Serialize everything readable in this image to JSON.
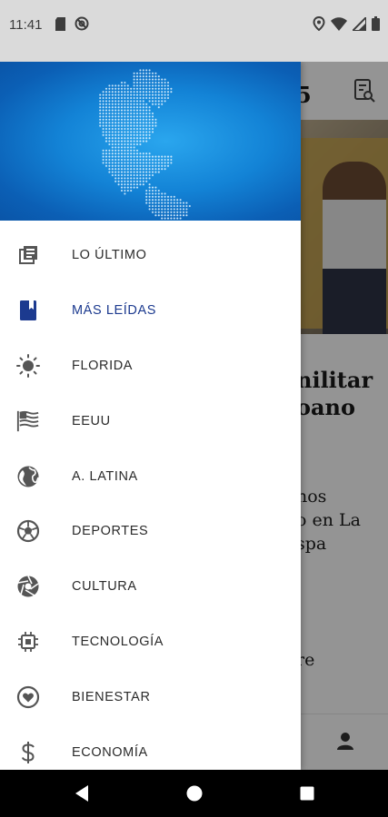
{
  "status_bar": {
    "time": "11:41",
    "left_icons": [
      "sd-card-icon",
      "do-not-disturb-icon"
    ],
    "right_icons": [
      "location-icon",
      "wifi-icon",
      "signal-icon",
      "battery-icon"
    ]
  },
  "background": {
    "headline_fragment_1": "nilitar",
    "headline_fragment_2": "oano",
    "story_fragment_1": "nos",
    "story_fragment_2": "o en La",
    "story_fragment_3": "spa",
    "story_fragment_4": "re",
    "app_fragment": "5"
  },
  "drawer": {
    "items": [
      {
        "label": "LO ÚLTIMO",
        "icon": "latest-stack-icon",
        "active": false
      },
      {
        "label": "MÁS LEÍDAS",
        "icon": "bookmark-book-icon",
        "active": true
      },
      {
        "label": "FLORIDA",
        "icon": "sun-icon",
        "active": false
      },
      {
        "label": "EEUU",
        "icon": "us-flag-icon",
        "active": false
      },
      {
        "label": "A. LATINA",
        "icon": "globe-icon",
        "active": false
      },
      {
        "label": "DEPORTES",
        "icon": "soccer-ball-icon",
        "active": false
      },
      {
        "label": "CULTURA",
        "icon": "camera-aperture-icon",
        "active": false
      },
      {
        "label": "TECNOLOGÍA",
        "icon": "chip-icon",
        "active": false
      },
      {
        "label": "BIENESTAR",
        "icon": "heart-icon",
        "active": false
      },
      {
        "label": "ECONOMÍA",
        "icon": "dollar-icon",
        "active": false
      }
    ]
  },
  "colors": {
    "accent": "#1c3a8f",
    "header_blue": "#1383d6",
    "icon_gray": "#555555"
  }
}
